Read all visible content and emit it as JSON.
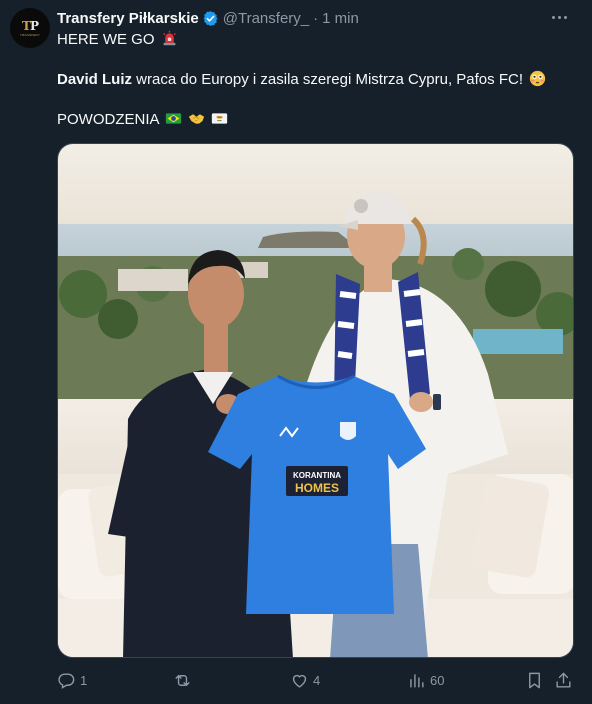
{
  "author": {
    "display_name": "Transfery Piłkarskie",
    "handle": "@Transfery_",
    "separator": "·",
    "time": "1 min",
    "avatar_monogram_a": "T",
    "avatar_monogram_b": "P",
    "avatar_subtext": "TRANSFERY"
  },
  "tweet": {
    "line1": "HERE WE GO",
    "line1_emoji": "siren-emoji",
    "line2_bold": "David Luiz",
    "line2_rest": " wraca do Europy i zasila szeregi Mistrza Cypru, Pafos FC!",
    "line2_emoji": "flushed-face-emoji",
    "line3": "POWODZENIA",
    "line3_emojis": [
      "brazil-flag-emoji",
      "handshake-emoji",
      "cyprus-flag-emoji"
    ]
  },
  "photo": {
    "shirt_sponsor_top": "KORANTINA",
    "shirt_sponsor_bottom": "HOMES"
  },
  "actions": {
    "reply_count": "1",
    "retweet_count": "",
    "like_count": "4",
    "views_count": "60"
  },
  "colors": {
    "background": "#15202b",
    "text": "#f7f9f9",
    "muted": "#8b98a5",
    "verified": "#1d9bf0",
    "shirt": "#2f7fe0"
  }
}
